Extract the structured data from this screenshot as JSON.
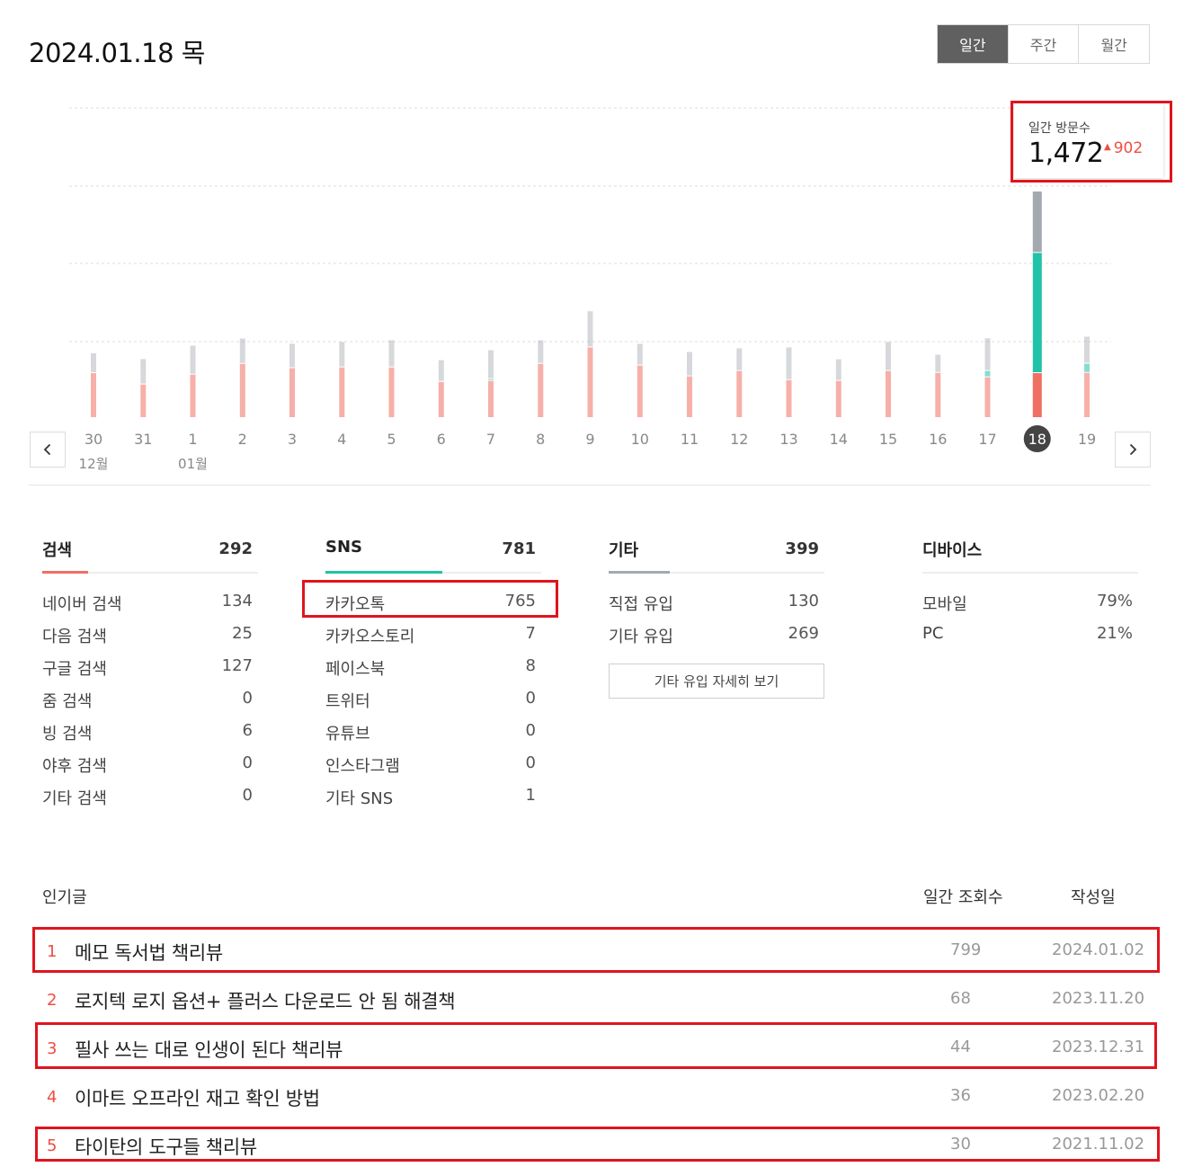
{
  "header": {
    "date": "2024.01.18 목",
    "tabs": [
      {
        "label": "일간",
        "active": true
      },
      {
        "label": "주간",
        "active": false
      },
      {
        "label": "월간",
        "active": false
      }
    ]
  },
  "visits": {
    "label": "일간 방문수",
    "value": "1,472",
    "delta": "902",
    "delta_icon": "up-triangle-icon"
  },
  "chart_data": {
    "type": "bar",
    "stacked": true,
    "selected_day": "18",
    "grid": true,
    "ylim": [
      0,
      1472
    ],
    "categories": [
      "30",
      "31",
      "1",
      "2",
      "3",
      "4",
      "5",
      "6",
      "7",
      "8",
      "9",
      "10",
      "11",
      "12",
      "13",
      "14",
      "15",
      "16",
      "17",
      "18",
      "19"
    ],
    "month_labels": [
      {
        "at": "30",
        "label": "12월"
      },
      {
        "at": "1",
        "label": "01월"
      }
    ],
    "series": [
      {
        "color": "#ef6f63",
        "values": [
          292,
          218,
          282,
          352,
          324,
          329,
          329,
          235,
          241,
          352,
          459,
          341,
          271,
          306,
          247,
          241,
          306,
          294,
          265,
          292,
          294
        ]
      },
      {
        "color": "#1fc3a7",
        "values": [
          0,
          0,
          0,
          0,
          0,
          0,
          0,
          0,
          12,
          0,
          0,
          0,
          0,
          0,
          0,
          0,
          0,
          0,
          41,
          781,
          59
        ]
      },
      {
        "color": "#a4a9b0",
        "values": [
          129,
          165,
          188,
          165,
          159,
          165,
          176,
          141,
          188,
          153,
          235,
          141,
          159,
          147,
          212,
          141,
          188,
          118,
          212,
          399,
          176
        ]
      }
    ]
  },
  "stats": {
    "search": {
      "name": "검색",
      "total": "292",
      "color": "#ef6f63",
      "share": 0.21,
      "rows": [
        {
          "k": "네이버 검색",
          "v": "134"
        },
        {
          "k": "다음 검색",
          "v": "25"
        },
        {
          "k": "구글 검색",
          "v": "127"
        },
        {
          "k": "줌 검색",
          "v": "0"
        },
        {
          "k": "빙 검색",
          "v": "6"
        },
        {
          "k": "야후 검색",
          "v": "0"
        },
        {
          "k": "기타 검색",
          "v": "0"
        }
      ]
    },
    "sns": {
      "name": "SNS",
      "total": "781",
      "color": "#1fc3a7",
      "share": 0.54,
      "rows": [
        {
          "k": "카카오톡",
          "v": "765"
        },
        {
          "k": "카카오스토리",
          "v": "7"
        },
        {
          "k": "페이스북",
          "v": "8"
        },
        {
          "k": "트위터",
          "v": "0"
        },
        {
          "k": "유튜브",
          "v": "0"
        },
        {
          "k": "인스타그램",
          "v": "0"
        },
        {
          "k": "기타 SNS",
          "v": "1"
        }
      ]
    },
    "etc": {
      "name": "기타",
      "total": "399",
      "color": "#a4a9b0",
      "share": 0.28,
      "rows": [
        {
          "k": "직접 유입",
          "v": "130"
        },
        {
          "k": "기타 유입",
          "v": "269"
        }
      ],
      "detail_button": "기타 유입 자세히 보기"
    },
    "device": {
      "name": "디바이스",
      "total": "",
      "rows": [
        {
          "k": "모바일",
          "v": "79%"
        },
        {
          "k": "PC",
          "v": "21%"
        }
      ]
    }
  },
  "popular": {
    "title": "인기글",
    "views_header": "일간 조회수",
    "date_header": "작성일",
    "posts": [
      {
        "rank": "1",
        "title": "메모 독서법 책리뷰",
        "views": "799",
        "date": "2024.01.02"
      },
      {
        "rank": "2",
        "title": "로지텍 로지 옵션+ 플러스 다운로드 안 됨 해결책",
        "views": "68",
        "date": "2023.11.20"
      },
      {
        "rank": "3",
        "title": "필사 쓰는 대로 인생이 된다 책리뷰",
        "views": "44",
        "date": "2023.12.31"
      },
      {
        "rank": "4",
        "title": "이마트 오프라인 재고 확인 방법",
        "views": "36",
        "date": "2023.02.20"
      },
      {
        "rank": "5",
        "title": "타이탄의 도구들 책리뷰",
        "views": "30",
        "date": "2021.11.02"
      }
    ]
  },
  "highlight_color": "#e0141e"
}
